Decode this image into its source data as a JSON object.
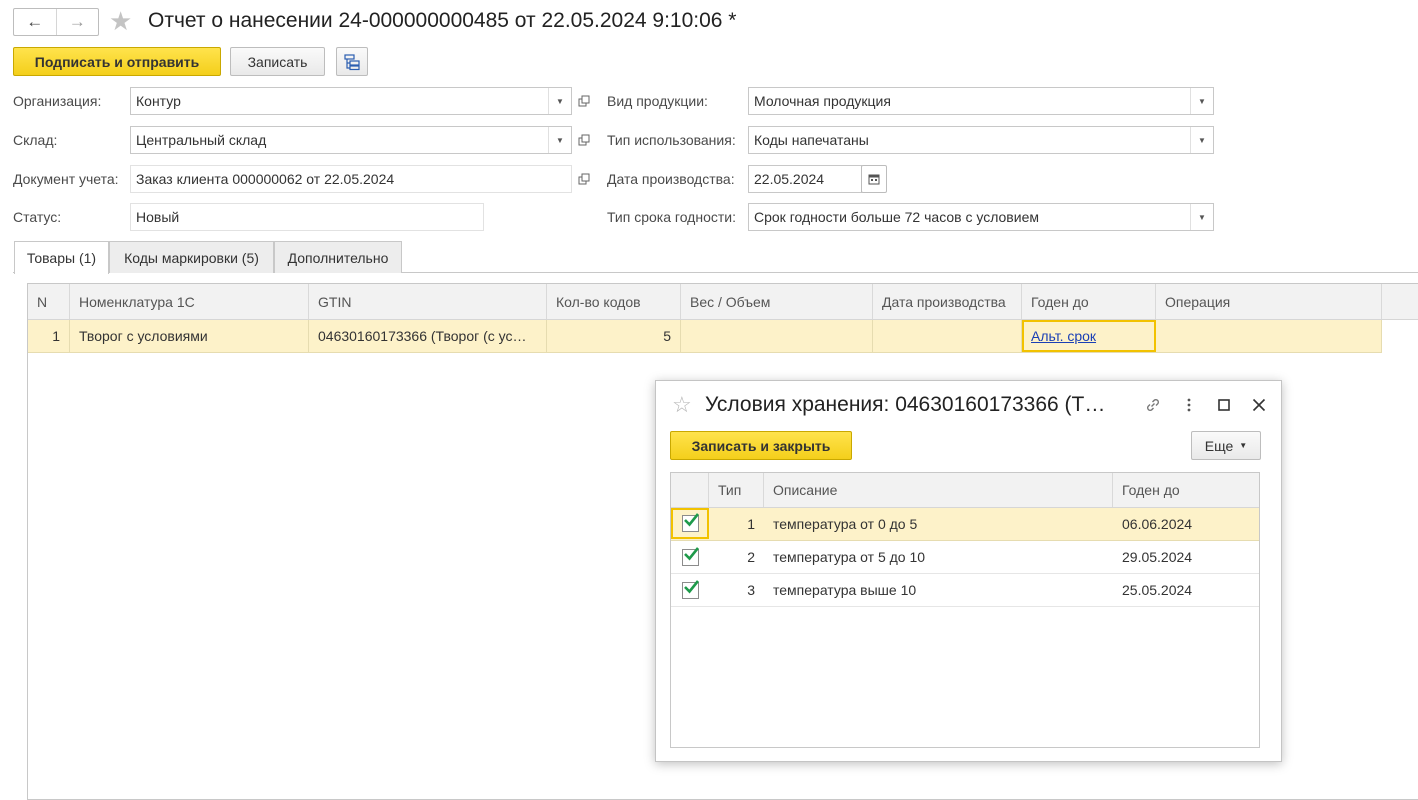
{
  "header": {
    "title": "Отчет о нанесении 24-000000000485 от 22.05.2024 9:10:06 *",
    "back_icon": "←",
    "forward_icon": "→",
    "star_icon": "★"
  },
  "toolbar": {
    "sign_send": "Подписать и отправить",
    "save": "Записать"
  },
  "form": {
    "org_label": "Организация:",
    "org_value": "Контур",
    "warehouse_label": "Склад:",
    "warehouse_value": "Центральный склад",
    "doc_label": "Документ учета:",
    "doc_value": "Заказ клиента 000000062 от 22.05.2024",
    "status_label": "Статус:",
    "status_value": "Новый",
    "product_label": "Вид продукции:",
    "product_value": "Молочная продукция",
    "usage_label": "Тип использования:",
    "usage_value": "Коды напечатаны",
    "proddate_label": "Дата производства:",
    "proddate_value": "22.05.2024",
    "shelf_label": "Тип срока годности:",
    "shelf_value": "Срок годности больше 72 часов с условием"
  },
  "tabs": [
    {
      "label": "Товары (1)"
    },
    {
      "label": "Коды маркировки (5)"
    },
    {
      "label": "Дополнительно"
    }
  ],
  "grid": {
    "columns": [
      "N",
      "Номенклатура 1С",
      "GTIN",
      "Кол-во кодов",
      "Вес / Объем",
      "Дата производства",
      "Годен до",
      "Операция"
    ],
    "rows": [
      {
        "n": "1",
        "nomenclature": "Творог с условиями",
        "gtin": "04630160173366 (Творог (с ус…",
        "count": "5",
        "weight": "",
        "proddate": "",
        "expiry": "Альт. срок",
        "operation": ""
      }
    ]
  },
  "dialog": {
    "title": "Условия хранения: 04630160173366 (Т…",
    "save_close": "Записать и закрыть",
    "more": "Еще",
    "columns": [
      "",
      "Тип",
      "Описание",
      "Годен до"
    ],
    "rows": [
      {
        "checked": true,
        "type": "1",
        "description": "температура от 0 до 5",
        "expiry": "06.06.2024"
      },
      {
        "checked": true,
        "type": "2",
        "description": "температура от 5 до 10",
        "expiry": "29.05.2024"
      },
      {
        "checked": true,
        "type": "3",
        "description": "температура выше 10",
        "expiry": "25.05.2024"
      }
    ]
  },
  "colors": {
    "accent_yellow": "#f4cf1b",
    "selected_row": "#fdf2c9",
    "check_green": "#1e9a4a",
    "link_blue": "#1a3fb5"
  }
}
